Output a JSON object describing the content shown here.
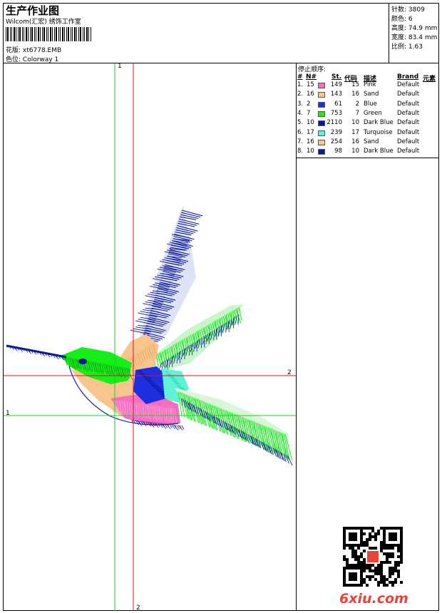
{
  "header": {
    "title": "生产作业图",
    "company": "Wilcom(汇宏) 绣饰工作室",
    "design_label": "花版:",
    "design_value": "xt6778.EMB",
    "colorway_label": "色位:",
    "colorway_value": "Colorway 1"
  },
  "stats": [
    {
      "label": "针数:",
      "value": "3809"
    },
    {
      "label": "颜色:",
      "value": "6"
    },
    {
      "label": "高度:",
      "value": "74.9 mm"
    },
    {
      "label": "宽度:",
      "value": "83.4 mm"
    },
    {
      "label": "比例:",
      "value": "1.63"
    }
  ],
  "stop_sequence": {
    "title": "停止顺序:",
    "headers": [
      "#",
      "N#",
      "St.",
      "代码",
      "描述",
      "Brand",
      "元素"
    ],
    "rows": [
      {
        "seq": "1.",
        "n": "15",
        "color": "#f46fc0",
        "st": "149",
        "code": "15",
        "desc": "Pink",
        "brand": "Default"
      },
      {
        "seq": "2.",
        "n": "16",
        "color": "#f8c68c",
        "st": "143",
        "code": "16",
        "desc": "Sand",
        "brand": "Default"
      },
      {
        "seq": "3.",
        "n": "2",
        "color": "#1e2fe0",
        "st": "61",
        "code": "2",
        "desc": "Blue",
        "brand": "Default"
      },
      {
        "seq": "4.",
        "n": "7",
        "color": "#16ee1a",
        "st": "753",
        "code": "7",
        "desc": "Green",
        "brand": "Default"
      },
      {
        "seq": "5.",
        "n": "10",
        "color": "#0c1a9a",
        "st": "2110",
        "code": "10",
        "desc": "Dark Blue",
        "brand": "Default"
      },
      {
        "seq": "6.",
        "n": "17",
        "color": "#5ef2d6",
        "st": "239",
        "code": "17",
        "desc": "Turquoise",
        "brand": "Default"
      },
      {
        "seq": "7.",
        "n": "16",
        "color": "#f8c68c",
        "st": "254",
        "code": "16",
        "desc": "Sand",
        "brand": "Default"
      },
      {
        "seq": "8.",
        "n": "10",
        "color": "#0c1a9a",
        "st": "98",
        "code": "10",
        "desc": "Dark Blue",
        "brand": "Default"
      }
    ]
  },
  "guides": {
    "v_green": "1",
    "v_red": "2",
    "h_red": "2",
    "h_green": "1",
    "green_color": "#1ad11a",
    "red_color": "#e0102a"
  },
  "watermark": "6xiu.com"
}
